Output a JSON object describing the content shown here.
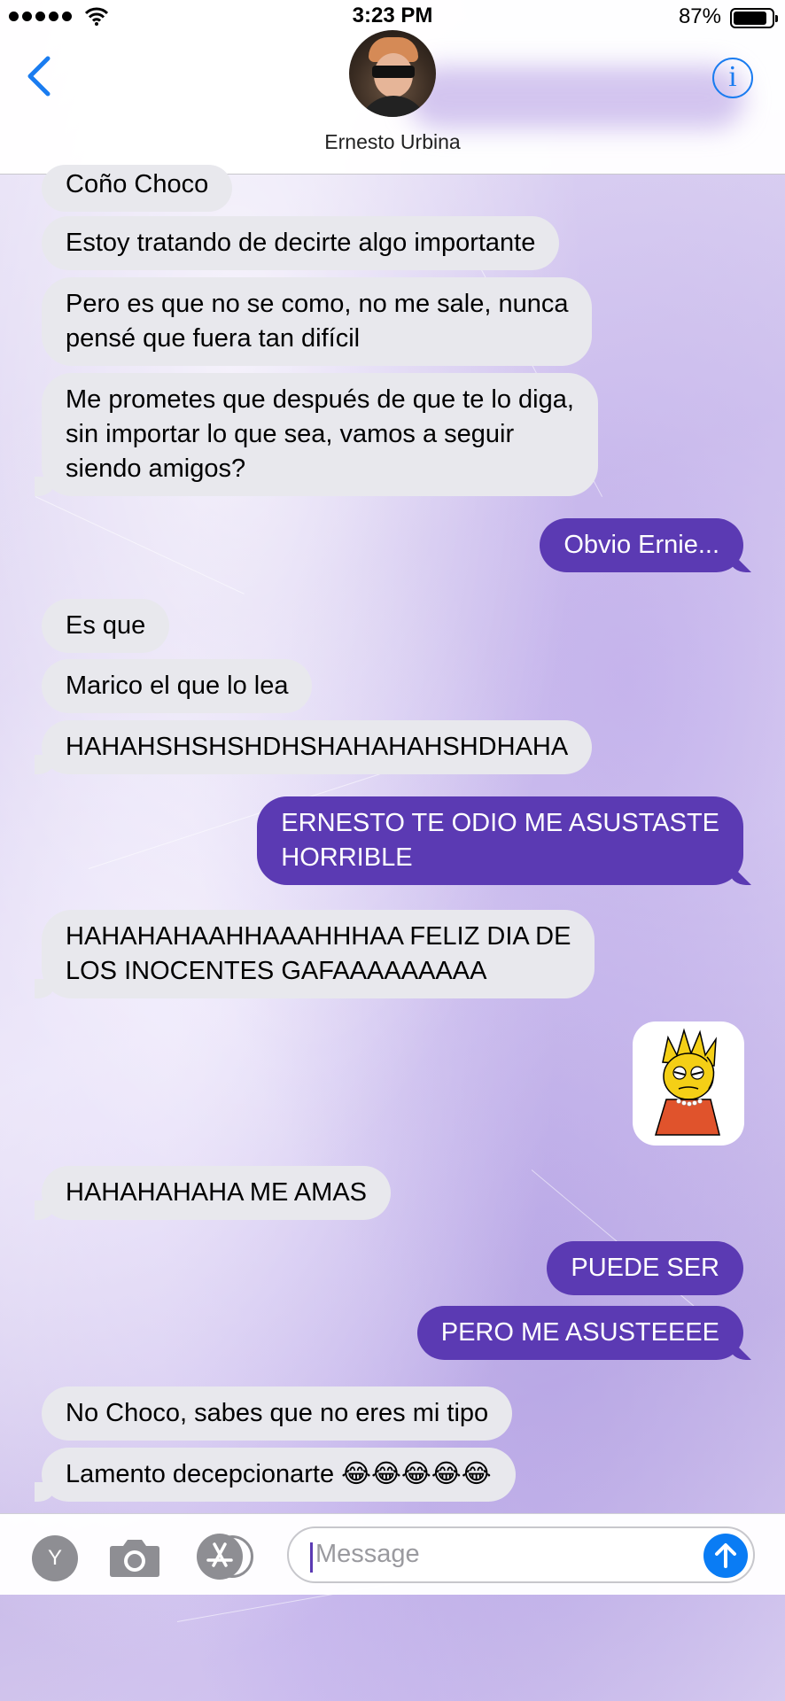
{
  "status_bar": {
    "time": "3:23 PM",
    "battery": "87%",
    "battery_level": 0.87
  },
  "header": {
    "contact_name": "Ernesto Urbina",
    "info_label": "i"
  },
  "messages": [
    {
      "from": "contact",
      "text": "Coño Choco"
    },
    {
      "from": "contact",
      "text": "Estoy tratando de decirte algo importante"
    },
    {
      "from": "contact",
      "line1": "Pero es que no se como, no me sale, nunca",
      "line2": "pensé que fuera tan difícil"
    },
    {
      "from": "contact",
      "line1": "Me prometes que después de que te lo diga,",
      "line2": "sin importar lo que sea, vamos a seguir",
      "line3": "siendo amigos?"
    },
    {
      "from": "me",
      "text": "Obvio Ernie..."
    },
    {
      "from": "contact",
      "text": "Es que"
    },
    {
      "from": "contact",
      "text": "Marico el que lo lea"
    },
    {
      "from": "contact",
      "text": "HAHAHSHSHSHDHSHAHAHAHSHDHAHA"
    },
    {
      "from": "me",
      "line1": "ERNESTO TE ODIO ME ASUSTASTE",
      "line2": "HORRIBLE"
    },
    {
      "from": "contact",
      "line1": "HAHAHAHAAHHAAAHHHAA FELIZ DIA DE",
      "line2": "LOS INOCENTES GAFAAAAAAAAA"
    },
    {
      "from": "me",
      "type": "sticker",
      "sticker": "lisa-simpson-facepalm"
    },
    {
      "from": "contact",
      "text": "HAHAHAHAHA ME AMAS"
    },
    {
      "from": "me",
      "text": "PUEDE SER"
    },
    {
      "from": "me",
      "text": "PERO ME ASUSTEEEE"
    },
    {
      "from": "contact",
      "text": "No Choco, sabes que no eres mi tipo"
    },
    {
      "from": "contact",
      "text": "Lamento decepcionarte 😂😂😂😂😂"
    }
  ],
  "input_bar": {
    "apps_label": "Y",
    "message_placeholder": "Message"
  },
  "colors": {
    "outgoing": "#5b3ab3",
    "incoming": "#e8e8ed",
    "accent": "#0a7cf4"
  },
  "icons": [
    "back-chevron-icon",
    "info-icon",
    "apps-icon",
    "camera-icon",
    "app-store-icon",
    "send-arrow-icon",
    "wifi-icon",
    "battery-icon"
  ]
}
